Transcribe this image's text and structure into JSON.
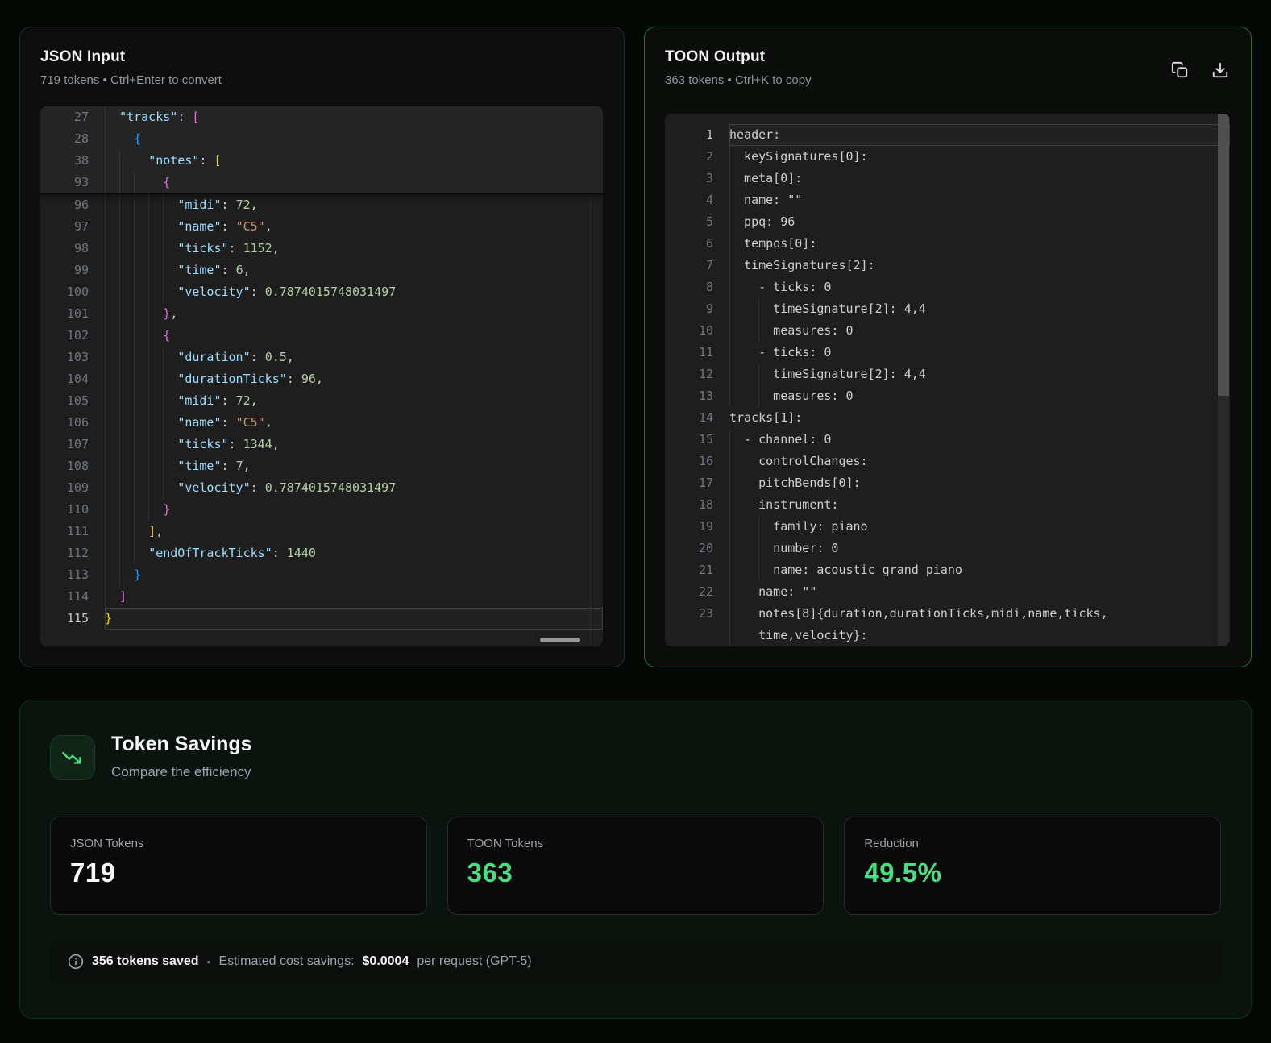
{
  "colors": {
    "accent_green": "#4ade80",
    "output_border_green": "#2f7a4f",
    "editor_bg": "#1e1e1e",
    "key_blue": "#9CDCFE",
    "string_orange": "#CE9178",
    "number_green": "#B5CEA8",
    "bracket_gold": "#FFD700",
    "bracket_pink": "#DA70D6",
    "bracket_blue": "#179FFF"
  },
  "icons": {
    "copy": "copy-icon",
    "download": "download-icon",
    "savings": "trending-down-icon",
    "info": "info-icon"
  },
  "json_panel": {
    "title": "JSON Input",
    "subtitle": "719 tokens • Ctrl+Enter to convert",
    "sticky_lines": [
      {
        "n": "27",
        "g": [
          0
        ],
        "t": [
          [
            "p",
            "  "
          ],
          [
            "k",
            "\"tracks\""
          ],
          [
            "p",
            ": "
          ],
          [
            "b2",
            "["
          ]
        ]
      },
      {
        "n": "28",
        "g": [
          0
        ],
        "t": [
          [
            "p",
            "    "
          ],
          [
            "b3",
            "{"
          ]
        ]
      },
      {
        "n": "38",
        "g": [
          0,
          2
        ],
        "t": [
          [
            "p",
            "      "
          ],
          [
            "k",
            "\"notes\""
          ],
          [
            "p",
            ": "
          ],
          [
            "b1",
            "["
          ]
        ]
      },
      {
        "n": "93",
        "g": [
          0,
          2,
          4
        ],
        "t": [
          [
            "p",
            "        "
          ],
          [
            "b2",
            "{"
          ]
        ]
      }
    ],
    "lines": [
      {
        "n": "96",
        "g": [
          0,
          2,
          4,
          6,
          8
        ],
        "t": [
          [
            "p",
            "          "
          ],
          [
            "k",
            "\"midi\""
          ],
          [
            "p",
            ": "
          ],
          [
            "n",
            "72"
          ],
          [
            "p",
            ","
          ]
        ]
      },
      {
        "n": "97",
        "g": [
          0,
          2,
          4,
          6,
          8
        ],
        "t": [
          [
            "p",
            "          "
          ],
          [
            "k",
            "\"name\""
          ],
          [
            "p",
            ": "
          ],
          [
            "s",
            "\"C5\""
          ],
          [
            "p",
            ","
          ]
        ]
      },
      {
        "n": "98",
        "g": [
          0,
          2,
          4,
          6,
          8
        ],
        "t": [
          [
            "p",
            "          "
          ],
          [
            "k",
            "\"ticks\""
          ],
          [
            "p",
            ": "
          ],
          [
            "n",
            "1152"
          ],
          [
            "p",
            ","
          ]
        ]
      },
      {
        "n": "99",
        "g": [
          0,
          2,
          4,
          6,
          8
        ],
        "t": [
          [
            "p",
            "          "
          ],
          [
            "k",
            "\"time\""
          ],
          [
            "p",
            ": "
          ],
          [
            "n",
            "6"
          ],
          [
            "p",
            ","
          ]
        ]
      },
      {
        "n": "100",
        "g": [
          0,
          2,
          4,
          6,
          8
        ],
        "t": [
          [
            "p",
            "          "
          ],
          [
            "k",
            "\"velocity\""
          ],
          [
            "p",
            ": "
          ],
          [
            "n",
            "0.7874015748031497"
          ]
        ]
      },
      {
        "n": "101",
        "g": [
          0,
          2,
          4,
          6
        ],
        "t": [
          [
            "p",
            "        "
          ],
          [
            "b2",
            "}"
          ],
          [
            "p",
            ","
          ]
        ]
      },
      {
        "n": "102",
        "g": [
          0,
          2,
          4,
          6
        ],
        "t": [
          [
            "p",
            "        "
          ],
          [
            "b2",
            "{"
          ]
        ]
      },
      {
        "n": "103",
        "g": [
          0,
          2,
          4,
          6,
          8
        ],
        "t": [
          [
            "p",
            "          "
          ],
          [
            "k",
            "\"duration\""
          ],
          [
            "p",
            ": "
          ],
          [
            "n",
            "0.5"
          ],
          [
            "p",
            ","
          ]
        ]
      },
      {
        "n": "104",
        "g": [
          0,
          2,
          4,
          6,
          8
        ],
        "t": [
          [
            "p",
            "          "
          ],
          [
            "k",
            "\"durationTicks\""
          ],
          [
            "p",
            ": "
          ],
          [
            "n",
            "96"
          ],
          [
            "p",
            ","
          ]
        ]
      },
      {
        "n": "105",
        "g": [
          0,
          2,
          4,
          6,
          8
        ],
        "t": [
          [
            "p",
            "          "
          ],
          [
            "k",
            "\"midi\""
          ],
          [
            "p",
            ": "
          ],
          [
            "n",
            "72"
          ],
          [
            "p",
            ","
          ]
        ]
      },
      {
        "n": "106",
        "g": [
          0,
          2,
          4,
          6,
          8
        ],
        "t": [
          [
            "p",
            "          "
          ],
          [
            "k",
            "\"name\""
          ],
          [
            "p",
            ": "
          ],
          [
            "s",
            "\"C5\""
          ],
          [
            "p",
            ","
          ]
        ]
      },
      {
        "n": "107",
        "g": [
          0,
          2,
          4,
          6,
          8
        ],
        "t": [
          [
            "p",
            "          "
          ],
          [
            "k",
            "\"ticks\""
          ],
          [
            "p",
            ": "
          ],
          [
            "n",
            "1344"
          ],
          [
            "p",
            ","
          ]
        ]
      },
      {
        "n": "108",
        "g": [
          0,
          2,
          4,
          6,
          8
        ],
        "t": [
          [
            "p",
            "          "
          ],
          [
            "k",
            "\"time\""
          ],
          [
            "p",
            ": "
          ],
          [
            "n",
            "7"
          ],
          [
            "p",
            ","
          ]
        ]
      },
      {
        "n": "109",
        "g": [
          0,
          2,
          4,
          6,
          8
        ],
        "t": [
          [
            "p",
            "          "
          ],
          [
            "k",
            "\"velocity\""
          ],
          [
            "p",
            ": "
          ],
          [
            "n",
            "0.7874015748031497"
          ]
        ]
      },
      {
        "n": "110",
        "g": [
          0,
          2,
          4,
          6
        ],
        "t": [
          [
            "p",
            "        "
          ],
          [
            "b2",
            "}"
          ]
        ]
      },
      {
        "n": "111",
        "g": [
          0,
          2,
          4
        ],
        "t": [
          [
            "p",
            "      "
          ],
          [
            "b1",
            "]"
          ],
          [
            "p",
            ","
          ]
        ]
      },
      {
        "n": "112",
        "g": [
          0,
          2,
          4
        ],
        "t": [
          [
            "p",
            "      "
          ],
          [
            "k",
            "\"endOfTrackTicks\""
          ],
          [
            "p",
            ": "
          ],
          [
            "n",
            "1440"
          ]
        ]
      },
      {
        "n": "113",
        "g": [
          0,
          2
        ],
        "t": [
          [
            "p",
            "    "
          ],
          [
            "b3",
            "}"
          ]
        ]
      },
      {
        "n": "114",
        "g": [
          0
        ],
        "t": [
          [
            "p",
            "  "
          ],
          [
            "b2",
            "]"
          ]
        ]
      },
      {
        "n": "115",
        "g": [],
        "cur": true,
        "t": [
          [
            "b1",
            "}"
          ]
        ]
      }
    ]
  },
  "toon_panel": {
    "title": "TOON Output",
    "subtitle": "363 tokens • Ctrl+K to copy",
    "lines": [
      {
        "n": "1",
        "g": [],
        "cur": true,
        "t": [
          [
            "t",
            "header:"
          ]
        ]
      },
      {
        "n": "2",
        "g": [
          0
        ],
        "t": [
          [
            "t",
            "  keySignatures[0]:"
          ]
        ]
      },
      {
        "n": "3",
        "g": [
          0
        ],
        "t": [
          [
            "t",
            "  meta[0]:"
          ]
        ]
      },
      {
        "n": "4",
        "g": [
          0
        ],
        "t": [
          [
            "t",
            "  name: \"\""
          ]
        ]
      },
      {
        "n": "5",
        "g": [
          0
        ],
        "t": [
          [
            "t",
            "  ppq: 96"
          ]
        ]
      },
      {
        "n": "6",
        "g": [
          0
        ],
        "t": [
          [
            "t",
            "  tempos[0]:"
          ]
        ]
      },
      {
        "n": "7",
        "g": [
          0
        ],
        "t": [
          [
            "t",
            "  timeSignatures[2]:"
          ]
        ]
      },
      {
        "n": "8",
        "g": [
          0
        ],
        "t": [
          [
            "t",
            "    - ticks: 0"
          ]
        ]
      },
      {
        "n": "9",
        "g": [
          0,
          4
        ],
        "t": [
          [
            "t",
            "      timeSignature[2]: 4,4"
          ]
        ]
      },
      {
        "n": "10",
        "g": [
          0,
          4
        ],
        "t": [
          [
            "t",
            "      measures: 0"
          ]
        ]
      },
      {
        "n": "11",
        "g": [
          0
        ],
        "t": [
          [
            "t",
            "    - ticks: 0"
          ]
        ]
      },
      {
        "n": "12",
        "g": [
          0,
          4
        ],
        "t": [
          [
            "t",
            "      timeSignature[2]: 4,4"
          ]
        ]
      },
      {
        "n": "13",
        "g": [
          0,
          4
        ],
        "t": [
          [
            "t",
            "      measures: 0"
          ]
        ]
      },
      {
        "n": "14",
        "g": [],
        "t": [
          [
            "t",
            "tracks[1]:"
          ]
        ]
      },
      {
        "n": "15",
        "g": [
          0
        ],
        "t": [
          [
            "t",
            "  - channel: 0"
          ]
        ]
      },
      {
        "n": "16",
        "g": [
          0
        ],
        "t": [
          [
            "t",
            "    controlChanges:"
          ]
        ]
      },
      {
        "n": "17",
        "g": [
          0
        ],
        "t": [
          [
            "t",
            "    pitchBends[0]:"
          ]
        ]
      },
      {
        "n": "18",
        "g": [
          0
        ],
        "t": [
          [
            "t",
            "    instrument:"
          ]
        ]
      },
      {
        "n": "19",
        "g": [
          0,
          4
        ],
        "t": [
          [
            "t",
            "      family: piano"
          ]
        ]
      },
      {
        "n": "20",
        "g": [
          0,
          4
        ],
        "t": [
          [
            "t",
            "      number: 0"
          ]
        ]
      },
      {
        "n": "21",
        "g": [
          0,
          4
        ],
        "t": [
          [
            "t",
            "      name: acoustic grand piano"
          ]
        ]
      },
      {
        "n": "22",
        "g": [
          0
        ],
        "t": [
          [
            "t",
            "    name: \"\""
          ]
        ]
      },
      {
        "n": "23",
        "g": [
          0
        ],
        "t": [
          [
            "t",
            "    notes[8]{duration,durationTicks,midi,name,ticks,"
          ]
        ]
      },
      {
        "n": "",
        "g": [
          0
        ],
        "t": [
          [
            "t",
            "    time,velocity}:"
          ]
        ]
      }
    ]
  },
  "token_savings": {
    "title": "Token Savings",
    "subtitle": "Compare the efficiency",
    "stats": [
      {
        "label": "JSON Tokens",
        "value": "719",
        "color": "#fafafa"
      },
      {
        "label": "TOON Tokens",
        "value": "363",
        "color": "#4ade80"
      },
      {
        "label": "Reduction",
        "value": "49.5%",
        "color": "#4ade80"
      }
    ],
    "footer": {
      "tokens_saved": "356 tokens saved",
      "sep": "•",
      "savings_prefix": "Estimated cost savings:",
      "savings_amount": "$0.0004",
      "savings_suffix": "per request (GPT-5)"
    }
  }
}
